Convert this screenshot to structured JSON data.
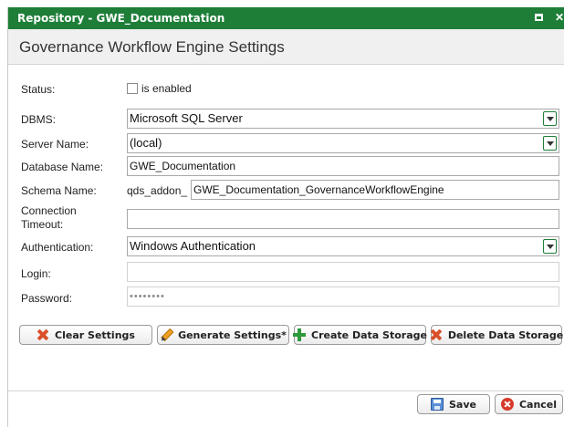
{
  "window": {
    "title": "Repository - GWE_Documentation"
  },
  "header": {
    "title": "Governance Workflow Engine Settings"
  },
  "form": {
    "status": {
      "label": "Status:",
      "checkbox_label": "is enabled",
      "checked": false
    },
    "dbms": {
      "label": "DBMS:",
      "value": "Microsoft SQL Server"
    },
    "server_name": {
      "label": "Server Name:",
      "value": "(local)"
    },
    "database_name": {
      "label": "Database Name:",
      "value": "GWE_Documentation"
    },
    "schema_name": {
      "label": "Schema Name:",
      "prefix": "qds_addon_",
      "value": "GWE_Documentation_GovernanceWorkflowEngine"
    },
    "connection_timeout": {
      "label_line1": "Connection",
      "label_line2": "Timeout:",
      "value": ""
    },
    "authentication": {
      "label": "Authentication:",
      "value": "Windows Authentication"
    },
    "login": {
      "label": "Login:",
      "value": ""
    },
    "password": {
      "label": "Password:",
      "value": "••••••••"
    }
  },
  "actions": {
    "clear_settings": "Clear Settings",
    "generate_settings": "Generate Settings*",
    "create_data_storage": "Create Data Storage",
    "delete_data_storage": "Delete Data Storage"
  },
  "footer": {
    "save": "Save",
    "cancel": "Cancel"
  },
  "icons": {
    "clear": "x-icon",
    "generate": "pencil-icon",
    "create": "plus-icon",
    "delete": "x-icon",
    "save": "floppy-disk-icon",
    "cancel": "cancel-circle-icon",
    "maximize": "maximize-icon",
    "close": "close-icon"
  },
  "colors": {
    "titlebar": "#1e7e38",
    "header_bg": "#f0f0f0"
  }
}
